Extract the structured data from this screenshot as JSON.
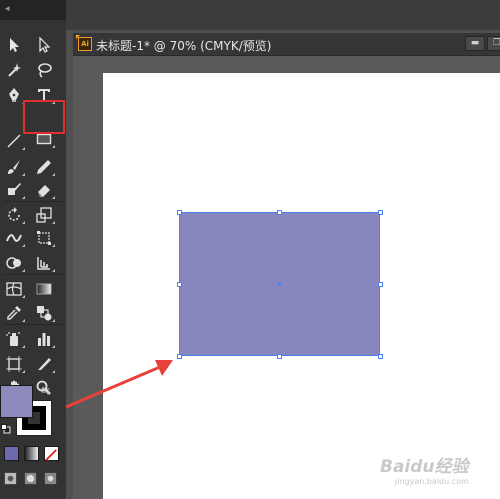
{
  "document": {
    "tab_title": "未标题-1* @ 70% (CMYK/预览)",
    "file_icon_label": "Ai"
  },
  "toolbar": {
    "collapse_glyph": "◂",
    "tools": [
      {
        "name": "selection-tool",
        "icon": "arrow-black"
      },
      {
        "name": "direct-selection-tool",
        "icon": "arrow-white"
      },
      {
        "name": "magic-wand-tool",
        "icon": "wand"
      },
      {
        "name": "lasso-tool",
        "icon": "lasso"
      },
      {
        "name": "pen-tool",
        "icon": "pen"
      },
      {
        "name": "type-tool",
        "icon": "type",
        "label": "T"
      },
      {
        "name": "line-segment-tool",
        "icon": "line"
      },
      {
        "name": "rectangle-tool",
        "icon": "rectangle",
        "selected": true
      },
      {
        "name": "paintbrush-tool",
        "icon": "brush"
      },
      {
        "name": "pencil-tool",
        "icon": "pencil"
      },
      {
        "name": "blob-brush-tool",
        "icon": "blob-brush"
      },
      {
        "name": "eraser-tool",
        "icon": "eraser"
      },
      {
        "name": "rotate-tool",
        "icon": "rotate"
      },
      {
        "name": "scale-tool",
        "icon": "scale"
      },
      {
        "name": "width-tool",
        "icon": "width"
      },
      {
        "name": "free-transform-tool",
        "icon": "free-transform"
      },
      {
        "name": "shape-builder-tool",
        "icon": "shape-builder"
      },
      {
        "name": "perspective-grid-tool",
        "icon": "perspective"
      },
      {
        "name": "mesh-tool",
        "icon": "mesh"
      },
      {
        "name": "gradient-tool",
        "icon": "gradient"
      },
      {
        "name": "eyedropper-tool",
        "icon": "eyedropper"
      },
      {
        "name": "blend-tool",
        "icon": "blend"
      },
      {
        "name": "symbol-sprayer-tool",
        "icon": "symbol-sprayer"
      },
      {
        "name": "column-graph-tool",
        "icon": "graph"
      },
      {
        "name": "artboard-tool",
        "icon": "artboard"
      },
      {
        "name": "slice-tool",
        "icon": "slice"
      },
      {
        "name": "hand-tool",
        "icon": "hand"
      },
      {
        "name": "zoom-tool",
        "icon": "zoom"
      }
    ],
    "fill_color": "#8e8abd",
    "stroke_color": "#000000"
  },
  "canvas": {
    "rectangle_fill": "#8787bd",
    "selection_color": "#4c7ff0",
    "highlight_color": "#e02f2f",
    "annotation_arrow_color": "#e8413c"
  },
  "watermark": {
    "brand": "Baidu经验",
    "url": "jingyan.baidu.com"
  }
}
